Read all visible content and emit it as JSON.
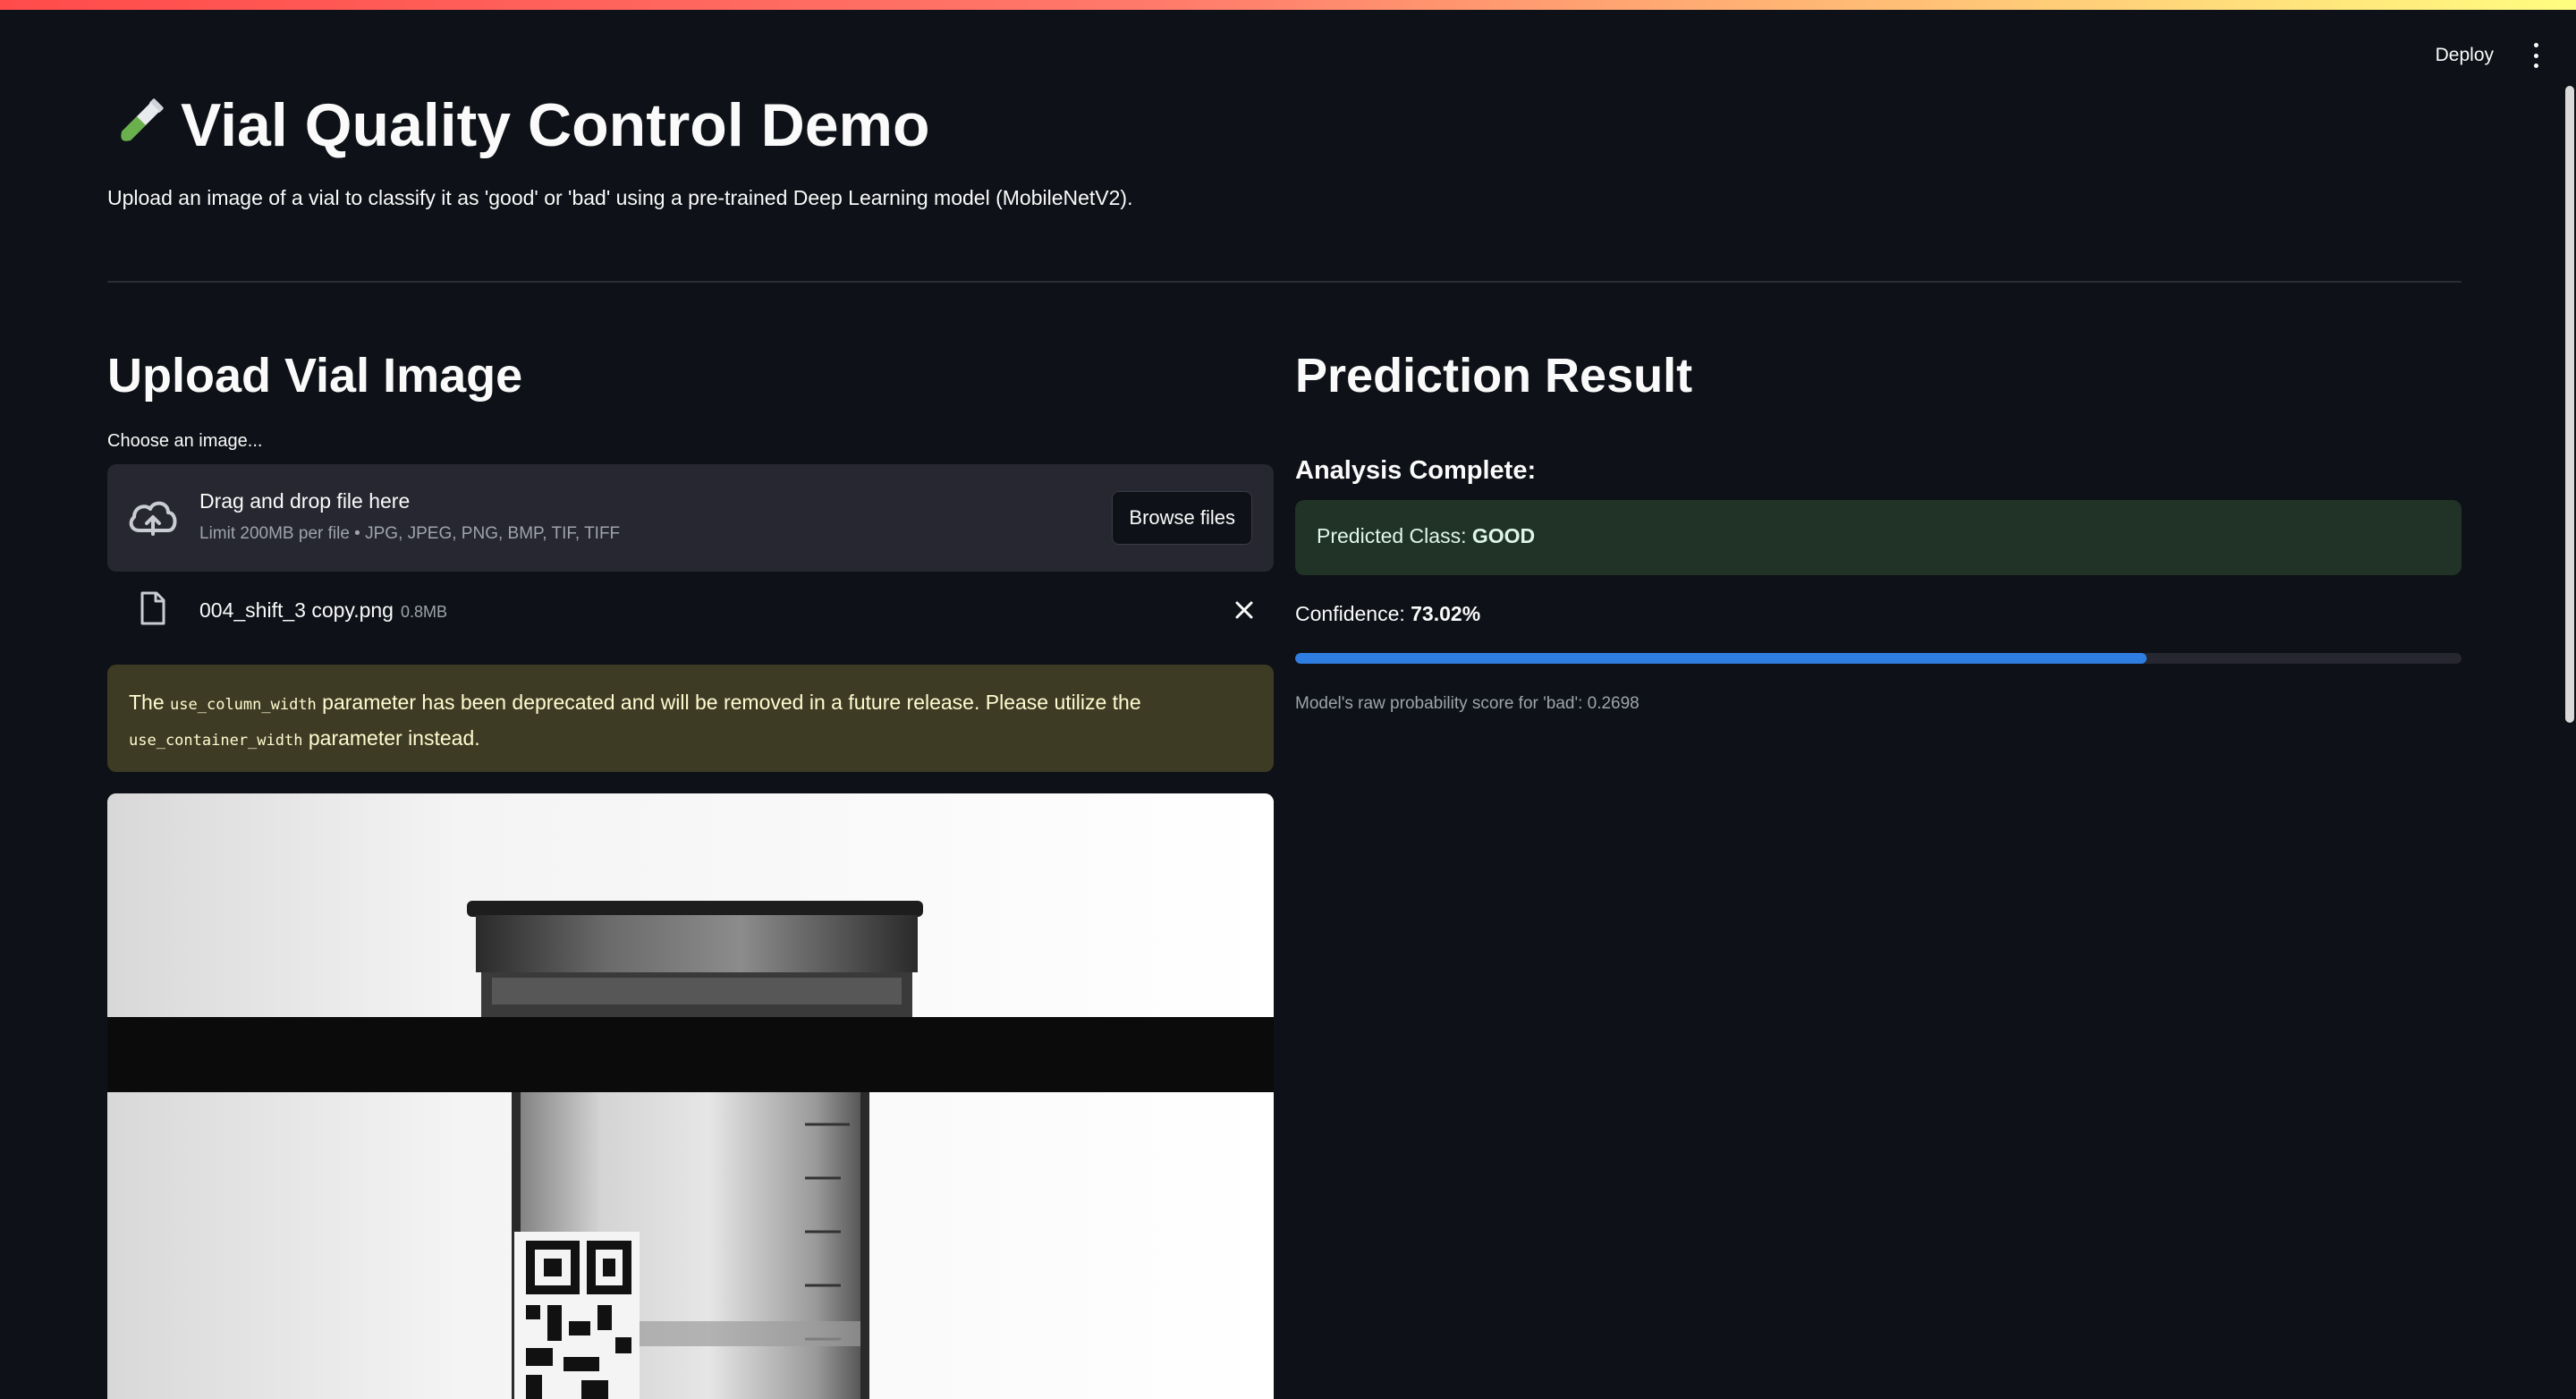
{
  "header": {
    "deploy_label": "Deploy",
    "menu_icon": "kebab-menu-icon"
  },
  "page": {
    "title_icon": "test-tube-icon",
    "title": "Vial Quality Control Demo",
    "subtitle": "Upload an image of a vial to classify it as 'good' or 'bad' using a pre-trained Deep Learning model (MobileNetV2)."
  },
  "upload": {
    "heading": "Upload Vial Image",
    "label": "Choose an image...",
    "drop_title": "Drag and drop file here",
    "drop_limit": "Limit 200MB per file • JPG, JPEG, PNG, BMP, TIF, TIFF",
    "browse_label": "Browse files",
    "file_name": "004_shift_3 copy.png",
    "file_size": "0.8MB"
  },
  "warning": {
    "p1": "The ",
    "code1": "use_column_width",
    "p2": " parameter has been deprecated and will be removed in a future release. Please utilize the ",
    "code2": "use_container_width",
    "p3": " parameter instead."
  },
  "result": {
    "heading": "Prediction Result",
    "analysis": "Analysis Complete:",
    "predicted_prefix": "Predicted Class: ",
    "predicted_value": "GOOD",
    "confidence_prefix": "Confidence: ",
    "confidence_value": "73.02%",
    "progress_fraction": 0.7302,
    "caption": "Model's raw probability score for 'bad': 0.2698"
  },
  "colors": {
    "background": "#0e1117",
    "success_bg": "#213327",
    "warning_bg": "#3d3b24",
    "progress": "#2f7de1"
  }
}
